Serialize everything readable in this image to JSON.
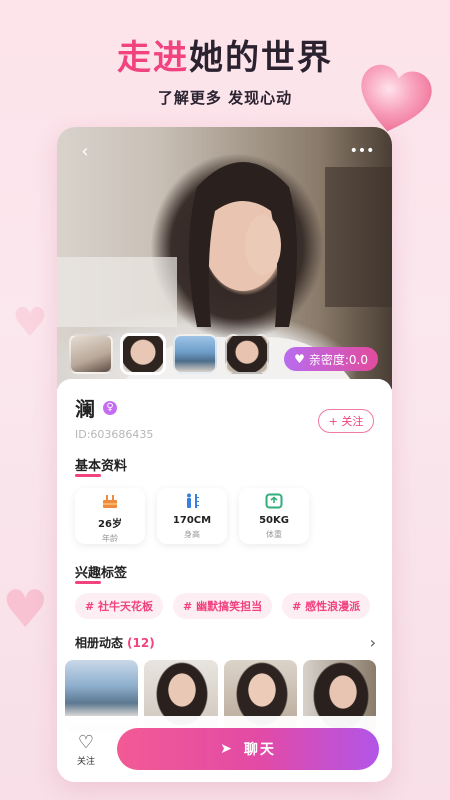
{
  "promo": {
    "title_pink": "走进",
    "title_rest": "她的世界",
    "subtitle": "了解更多 发现心动"
  },
  "photo": {
    "back_icon": "back-icon",
    "more_icon": "more-icon",
    "intimacy_label": "亲密度:0.0",
    "thumbnail_count": 4,
    "active_thumbnail": 2
  },
  "profile": {
    "name": "澜",
    "gender_icon": "female-icon",
    "id_text": "ID:603686435",
    "follow_button": "+ 关注"
  },
  "basic_info": {
    "title": "基本资料",
    "items": [
      {
        "icon": "cake-icon",
        "value": "26岁",
        "label": "年龄"
      },
      {
        "icon": "height-icon",
        "value": "170CM",
        "label": "身高"
      },
      {
        "icon": "scale-icon",
        "value": "50KG",
        "label": "体重"
      }
    ]
  },
  "interests": {
    "title": "兴趣标签",
    "tags": [
      "# 社牛天花板",
      "# 幽默搞笑担当",
      "# 感性浪漫派"
    ]
  },
  "album": {
    "title": "相册动态",
    "count": "(12)",
    "arrow_icon": "chevron-right-icon",
    "photo_count": 4
  },
  "bottom_bar": {
    "follow_label": "关注",
    "chat_label": "聊天"
  },
  "colors": {
    "accent": "#f0437f",
    "purple": "#b255e8",
    "tag_bg": "#fdeef3"
  }
}
